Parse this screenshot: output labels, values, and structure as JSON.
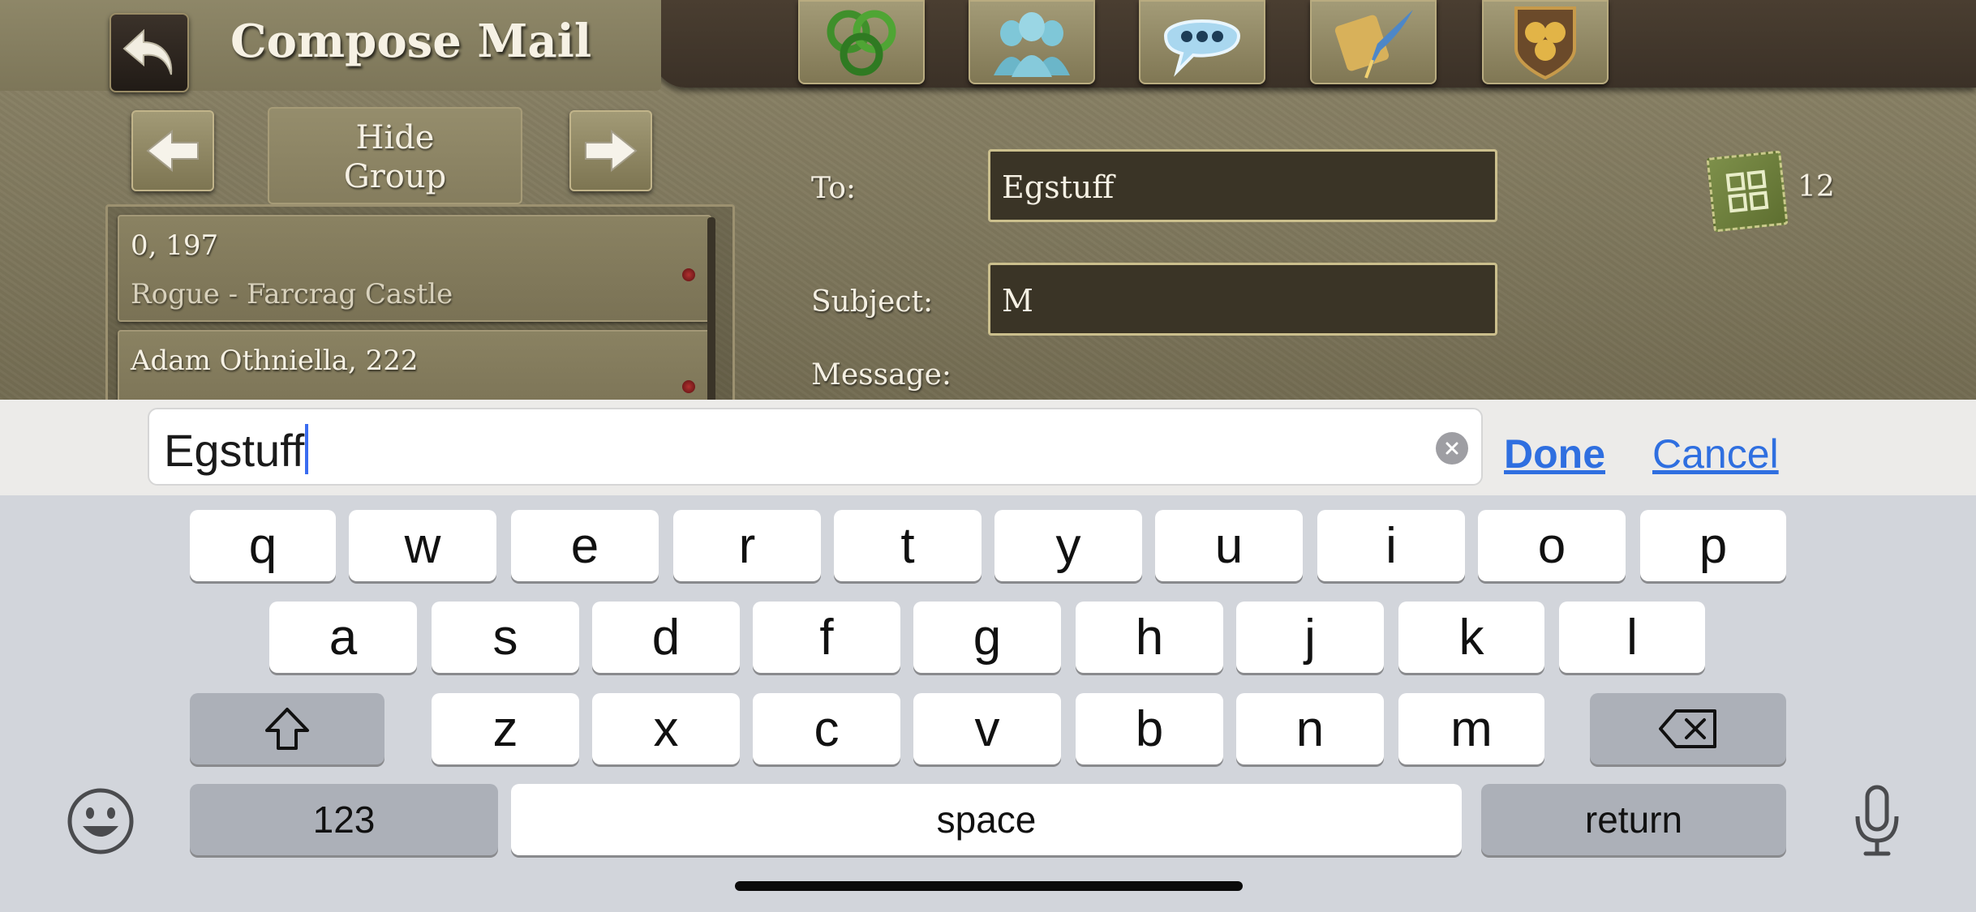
{
  "header": {
    "title": "Compose Mail",
    "nav_icons": [
      "triskelion-icon",
      "people-icon",
      "chat-bubble-icon",
      "scroll-quill-icon",
      "crest-shield-icon"
    ]
  },
  "group_nav": {
    "hide_group_label_line1": "Hide",
    "hide_group_label_line2": "Group"
  },
  "recipients": [
    {
      "line1": "0, 197",
      "line2": "Rogue - Farcrag Castle"
    },
    {
      "line1": "Adam Othniella, 222",
      "line2": ""
    }
  ],
  "form": {
    "to_label": "To:",
    "to_value": "Egstuff",
    "subject_label": "Subject:",
    "subject_value": "M",
    "message_label": "Message:"
  },
  "counter": {
    "icon": "celtic-knot-icon",
    "value": "12"
  },
  "input_bar": {
    "value": "Egstuff",
    "done_label": "Done",
    "cancel_label": "Cancel"
  },
  "keyboard": {
    "row1": [
      "q",
      "w",
      "e",
      "r",
      "t",
      "y",
      "u",
      "i",
      "o",
      "p"
    ],
    "row2": [
      "a",
      "s",
      "d",
      "f",
      "g",
      "h",
      "j",
      "k",
      "l"
    ],
    "row3": [
      "z",
      "x",
      "c",
      "v",
      "b",
      "n",
      "m"
    ],
    "numbers_label": "123",
    "space_label": "space",
    "return_label": "return"
  },
  "colors": {
    "accent_blue": "#2f6fe0",
    "game_panel": "#8c8468",
    "keyboard_bg": "#d2d5db"
  }
}
